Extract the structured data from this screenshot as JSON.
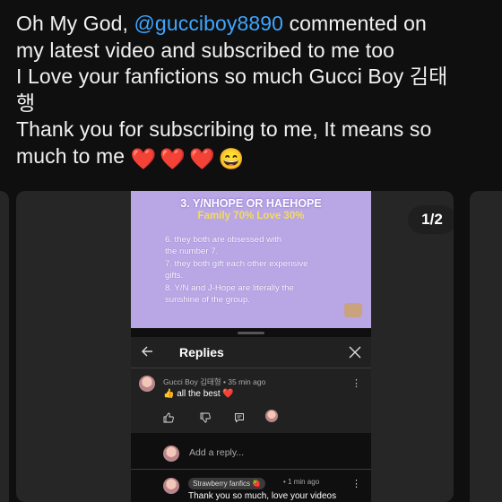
{
  "post": {
    "line1_prefix": "Oh My God, ",
    "mention": "@gucciboy8890",
    "line1_suffix": " commented on",
    "line2": "my latest video and subscribed to me too",
    "line3": "I Love your fanfictions so much Gucci Boy 김태",
    "line4": "행",
    "line5": "Thank you for subscribing to me, It means so",
    "line6_text": "much to me",
    "line6_emojis": [
      "❤️",
      "❤️",
      "❤️",
      "😄"
    ]
  },
  "media": {
    "counter": "1/2"
  },
  "slide": {
    "title": "3. Y/NHOPE OR HAEHOPE",
    "subtitle": "Family 70% Love 30%",
    "lines": [
      "6. they both are obsessed with",
      "the number 7.",
      "7. they both gift each other expensive",
      "gifts.",
      "8. Y/N and J-Hope are literally the",
      "sunshine of the group."
    ]
  },
  "replies_panel": {
    "title": "Replies",
    "comment": {
      "author": "Gucci Boy 김태형",
      "time": "• 35 min ago",
      "text": "👍 all the best ❤️"
    },
    "reply_placeholder": "Add a reply...",
    "reply": {
      "author": "Strawberry fanfics 🍓",
      "time": "• 1 min ago",
      "text": "Thank you so much, love your videos"
    }
  },
  "colors": {
    "background": "#0f0f0f",
    "mention": "#3ea6ff",
    "slide_bg": "#b9a6e4",
    "slide_subtitle": "#f3dc5b"
  }
}
